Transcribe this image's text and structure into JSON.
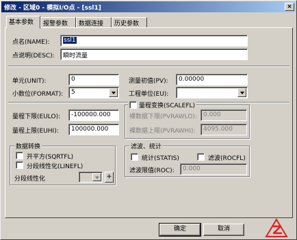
{
  "window": {
    "title": "修改 - 区域0 - 模拟I/O点 - [ssl1]",
    "close": "×"
  },
  "tabs": [
    {
      "label": "基本参数"
    },
    {
      "label": "报警参数"
    },
    {
      "label": "数据连接"
    },
    {
      "label": "历史参数"
    }
  ],
  "point": {
    "name_label": "点名(NAME):",
    "name_value": "ssl1",
    "desc_label": "点说明(DESC):",
    "desc_value": "瞬时流量"
  },
  "unit": {
    "unit_label": "单元(UNIT):",
    "unit_value": "0",
    "pv_label": "测量初值(PV):",
    "pv_value": "0.00000",
    "format_label": "小数位(FORMAT):",
    "format_value": "5",
    "eu_label": "工程单位(EU):",
    "eu_value": ""
  },
  "range": {
    "eulo_label": "量程下限(EULO):",
    "eulo_value": "-100000.000",
    "euhi_label": "量程上限(EUHI):",
    "euhi_value": "100000.000",
    "scale_title": "量程变换(SCALEFL)",
    "pvrawlo_label": "裸数据下限(PVRAWLO):",
    "pvrawlo_value": "0.000",
    "pvrawhi_label": "裸数据上限(PVRAWHI):",
    "pvrawhi_value": "4095.000"
  },
  "convert": {
    "title": "数据转换",
    "sqrt_label": "开平方(SQRTFL)",
    "linear_label": "分段线性化(LINEFL)",
    "piecewise_label": "分段线性化",
    "plus": "+"
  },
  "filter": {
    "title": "滤波、统计",
    "statis_label": "统计(STATIS)",
    "roc_label": "滤波(ROCFL)",
    "rocval_label": "滤波限值(ROC):",
    "rocval_value": "0.000"
  },
  "buttons": {
    "ok": "确定",
    "cancel": "取消"
  },
  "colors": {
    "title_start": "#0a246a",
    "title_end": "#a6caf0",
    "face": "#d4d0c8",
    "logo": "#e02020"
  }
}
